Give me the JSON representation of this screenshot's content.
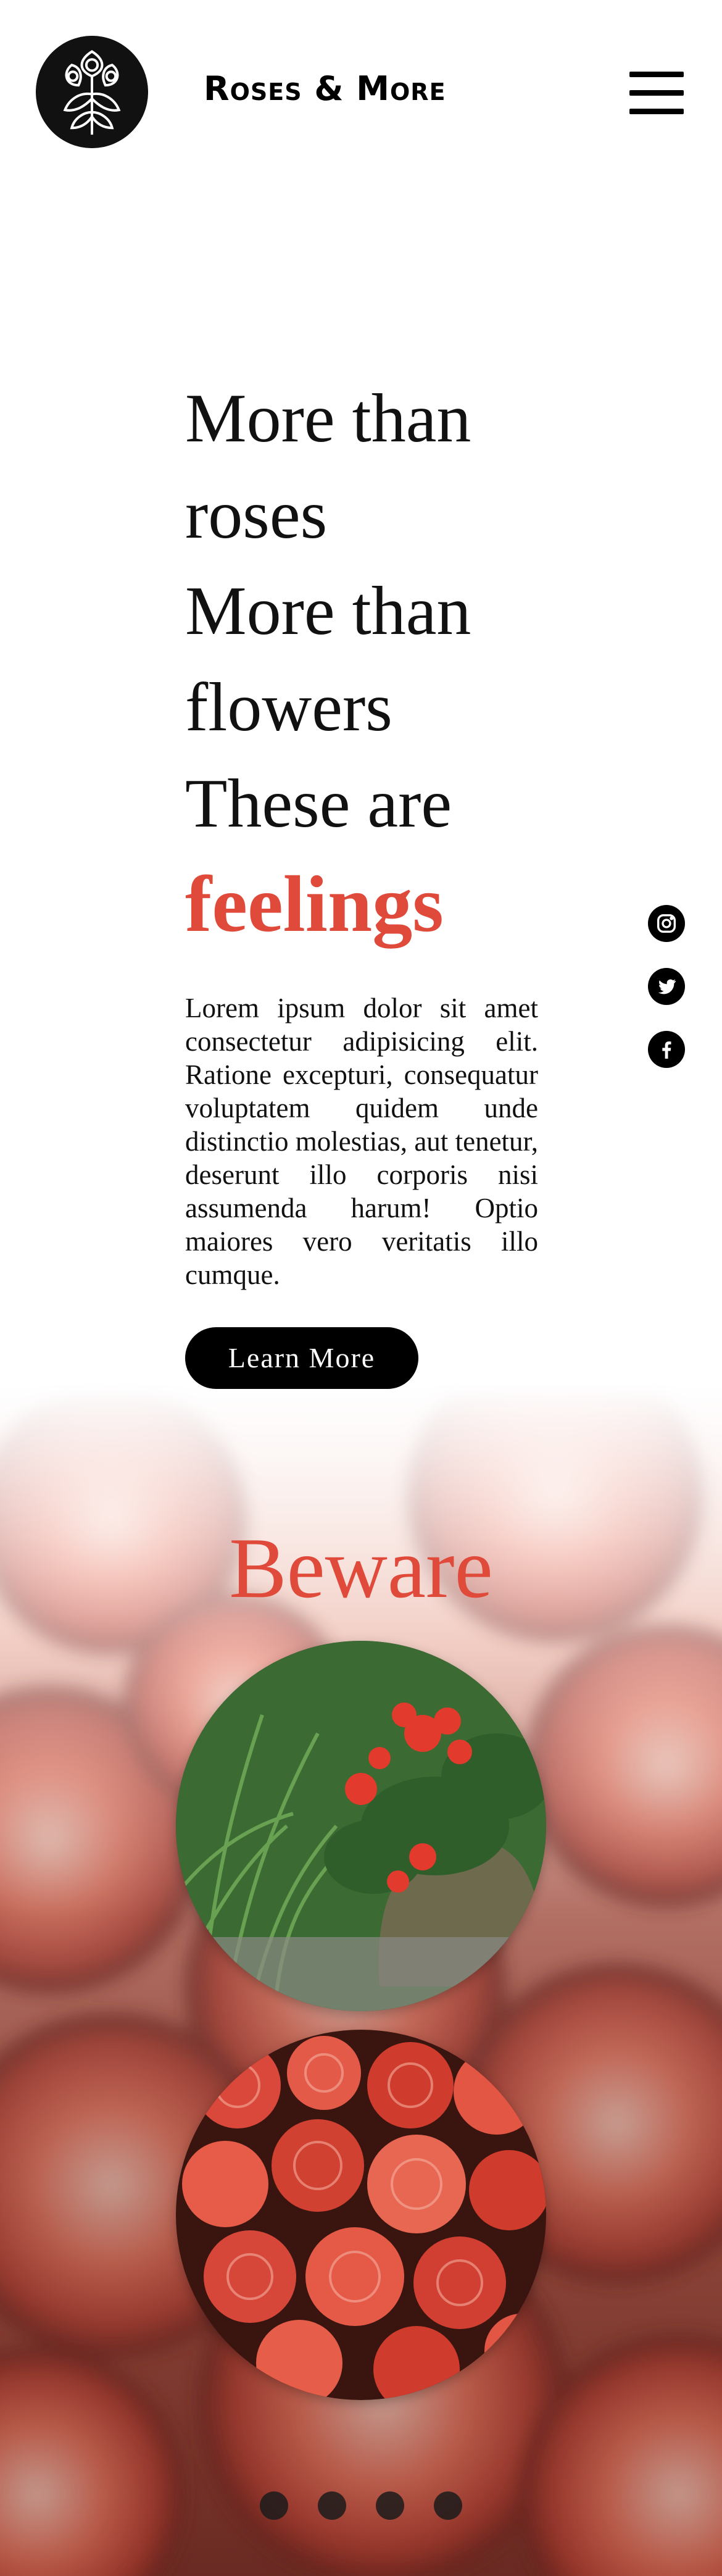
{
  "header": {
    "brand": "Roses & More",
    "menu_icon": "hamburger-menu-icon",
    "logo_icon": "rose-emblem-logo"
  },
  "hero": {
    "lines": [
      "More than",
      "roses",
      "More than",
      "flowers",
      "These are"
    ],
    "accent": "feelings",
    "body": "Lorem ipsum dolor sit amet consectetur adipisicing elit. Ratione excepturi, consequatur voluptatem quidem unde distinctio molestias, aut tenetur, deserunt illo corporis nisi assumenda harum! Optio maiores vero veritatis illo cumque.",
    "button": "Learn More"
  },
  "social": {
    "icons": [
      "instagram-icon",
      "twitter-icon",
      "facebook-icon"
    ]
  },
  "gallery": {
    "title": "Beware",
    "images": [
      "red-begonia-potted-plant",
      "red-begonia-blooms-closeup"
    ],
    "dots": 4
  },
  "colors": {
    "accent": "#e04a3a",
    "button_bg": "#000000"
  }
}
